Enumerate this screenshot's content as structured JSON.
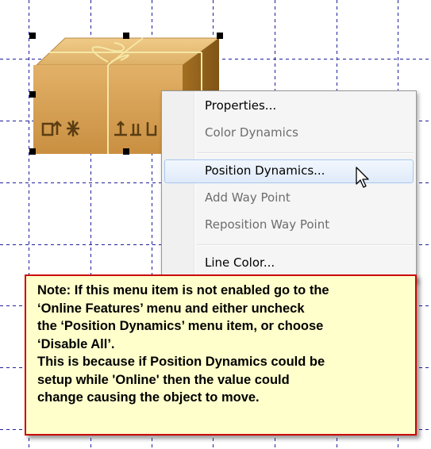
{
  "canvas": {
    "grid_color": "#1f1f9e",
    "selection_handle_color": "#000000"
  },
  "graphic_object": {
    "icon": "cardboard-box-icon",
    "colors": {
      "front": "#d8a557",
      "top": "#e9bf79",
      "side": "#a97628",
      "tape": "#f4e4a0",
      "symbols": "#4a3413"
    }
  },
  "context_menu": {
    "items": [
      {
        "label": "Properties...",
        "enabled": true,
        "highlighted": false
      },
      {
        "label": "Color Dynamics",
        "enabled": false,
        "highlighted": false
      },
      {
        "label": "Position Dynamics...",
        "enabled": true,
        "highlighted": true
      },
      {
        "label": "Add Way Point",
        "enabled": false,
        "highlighted": false
      },
      {
        "label": "Reposition Way Point",
        "enabled": false,
        "highlighted": false
      },
      {
        "label": "Line Color...",
        "enabled": true,
        "highlighted": false
      }
    ],
    "highlight_color": "#dfeaf9"
  },
  "cursor": {
    "icon": "mouse-pointer-icon"
  },
  "note": {
    "lines": [
      "Note: If this menu item is not enabled go to the",
      "‘Online Features’ menu and either uncheck",
      "the ‘Position Dynamics’ menu item, or choose",
      "‘Disable All’.",
      "This is because if Position Dynamics could be",
      "setup while 'Online' then the value could",
      "change causing the object to move."
    ],
    "background": "#ffffcc",
    "border_color": "#cc0000"
  }
}
